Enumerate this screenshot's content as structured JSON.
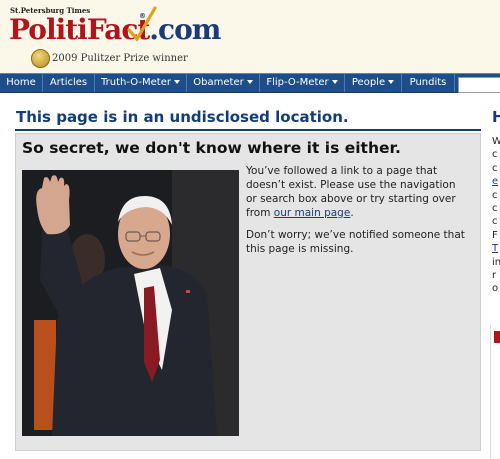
{
  "header": {
    "paper_name": "St.Petersburg Times",
    "logo_text": "PolitiFact",
    "logo_reg": "®",
    "logo_dot": ".com",
    "prize_text": "2009 Pulitzer Prize winner"
  },
  "nav": {
    "items": [
      {
        "label": "Home",
        "dropdown": false
      },
      {
        "label": "Articles",
        "dropdown": false
      },
      {
        "label": "Truth-O-Meter",
        "dropdown": true
      },
      {
        "label": "Obameter",
        "dropdown": true
      },
      {
        "label": "Flip-O-Meter",
        "dropdown": true
      },
      {
        "label": "People",
        "dropdown": true
      },
      {
        "label": "Pundits",
        "dropdown": false
      }
    ],
    "search_placeholder": ""
  },
  "main": {
    "page_title": "This page is in an undisclosed location.",
    "heading": "So secret, we don't know where it is either.",
    "message_1_pre": "You’ve followed a link to a page that doesn’t exist. Please use the navigation or search box above or try starting over from ",
    "message_1_link": "our main page",
    "message_1_post": ".",
    "message_2": "Don’t worry; we’ve notified someone that this page is missing."
  },
  "right_column": {
    "heading": "H",
    "lines": [
      "W",
      "c",
      "c",
      "e",
      "c",
      "c",
      "c",
      "F",
      "T",
      "in",
      "r",
      "o"
    ]
  },
  "colors": {
    "nav_bg": "#1e4e8a",
    "brand_red": "#b3131b",
    "brand_blue": "#123c7c",
    "header_bg": "#fbf8ea"
  }
}
